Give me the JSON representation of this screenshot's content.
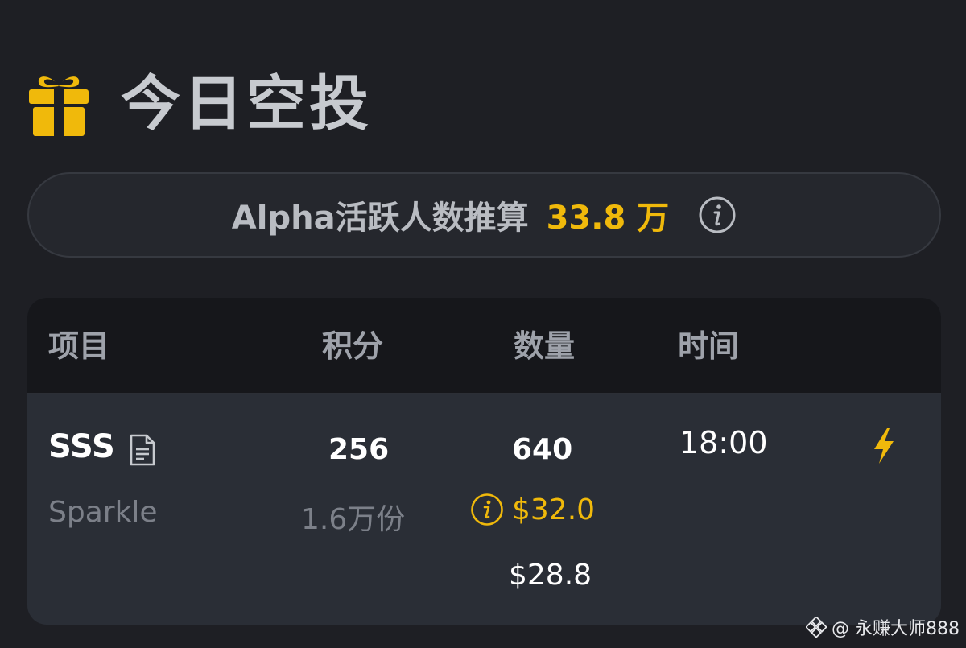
{
  "header": {
    "title": "今日空投",
    "icon": "gift-icon"
  },
  "stats": {
    "label": "Alpha活跃人数推算",
    "value": "33.8 万",
    "info_icon": "info-circle-icon"
  },
  "table": {
    "columns": [
      "项目",
      "积分",
      "数量",
      "时间"
    ],
    "rows": [
      {
        "symbol": "SSS",
        "name": "Sparkle",
        "doc_icon": "document-icon",
        "points": "256",
        "shares": "1.6万份",
        "amount": "640",
        "value": "$32.0",
        "price": "$28.8",
        "time": "18:00",
        "status_icon": "lightning-icon"
      }
    ]
  },
  "watermark": {
    "text": "@ 永赚大师888"
  },
  "colors": {
    "accent": "#f0b90b",
    "background": "#1e1f24",
    "card": "#2a2e36",
    "table_header": "#16171b"
  }
}
